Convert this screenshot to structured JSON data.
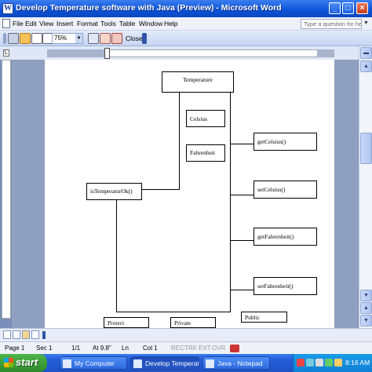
{
  "window": {
    "title": "Develop Temperature software with Java (Preview) - Microsoft Word",
    "minimize": "_",
    "maximize": "□",
    "close": "×"
  },
  "menu": {
    "items": [
      "File",
      "Edit",
      "View",
      "Insert",
      "Format",
      "Tools",
      "Table",
      "Window",
      "Help"
    ],
    "help_placeholder": "Type a question for help"
  },
  "toolbar": {
    "zoom": "75%",
    "close_label": "Close"
  },
  "diagram": {
    "temperature": "Temperature",
    "celsius": "Celsius",
    "fahrenheit": "Fahrenheit",
    "is_temperature_ok": "isTemperaturOk()",
    "get_celsius": "getCelsius()",
    "set_celsius": "setCelsius()",
    "get_fahrenheit": "getFahrenheit()",
    "set_fahrenheit": "setFahrenheit()",
    "protect": "Protect",
    "private": "Private",
    "public": "Public"
  },
  "status": {
    "page": "Page 1",
    "sec": "Sec 1",
    "pages": "1/1",
    "at": "At 9.8\"",
    "ln": "Ln",
    "col": "Col 1",
    "rec": "REC",
    "trk": "TRK",
    "ext": "EXT",
    "ovr": "OVR"
  },
  "taskbar": {
    "start": "start",
    "tasks": [
      "My Computer",
      "Develop Temperature...",
      "Java - Notepad"
    ],
    "clock": "8:16 AM"
  }
}
